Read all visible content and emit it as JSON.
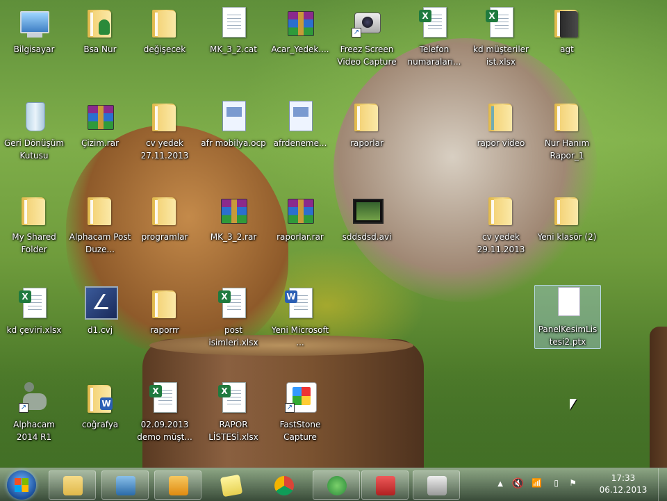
{
  "desktop_icons": [
    {
      "label": "Bilgisayar",
      "icon": "computer-icon"
    },
    {
      "label": "Bsa Nur",
      "icon": "user-folder-icon"
    },
    {
      "label": "değişecek",
      "icon": "folder-icon"
    },
    {
      "label": "MK_3_2.cat",
      "icon": "document-stack-icon"
    },
    {
      "label": "Acar_Yedek....",
      "icon": "winrar-archive-icon"
    },
    {
      "label": "Freez Screen Video Capture",
      "icon": "camera-icon"
    },
    {
      "label": "Telefon numaraları...",
      "icon": "excel-file-icon"
    },
    {
      "label": "kd müşteriler ist.xlsx",
      "icon": "excel-file-icon"
    },
    {
      "label": "agt",
      "icon": "folder-icon"
    },
    {
      "label": "Geri Dönüşüm Kutusu",
      "icon": "recycle-bin-icon"
    },
    {
      "label": "Çizim.rar",
      "icon": "winrar-archive-icon"
    },
    {
      "label": "cv yedek 27.11.2013",
      "icon": "folder-icon"
    },
    {
      "label": "afr mobilya.ocp",
      "icon": "ocp-file-icon"
    },
    {
      "label": "afrdeneme...",
      "icon": "ocp-file-icon"
    },
    {
      "label": "raporlar",
      "icon": "folder-icon"
    },
    {
      "label": "rapor video",
      "icon": "video-folder-icon"
    },
    {
      "label": "Nur Hanım Rapor_1",
      "icon": "folder-icon"
    },
    {
      "label": "My Shared Folder",
      "icon": "folder-icon"
    },
    {
      "label": "Alphacam Post Duze...",
      "icon": "folder-icon"
    },
    {
      "label": "programlar",
      "icon": "folder-icon"
    },
    {
      "label": "MK_3_2.rar",
      "icon": "winrar-archive-icon"
    },
    {
      "label": "raporlar.rar",
      "icon": "winrar-archive-icon"
    },
    {
      "label": "sddsdsd.avi",
      "icon": "video-file-icon"
    },
    {
      "label": "cv yedek 29.11.2013",
      "icon": "folder-icon"
    },
    {
      "label": "Yeni klasör (2)",
      "icon": "folder-icon"
    },
    {
      "label": "kd çeviri.xlsx",
      "icon": "excel-file-icon"
    },
    {
      "label": "d1.cvj",
      "icon": "cvj-file-icon"
    },
    {
      "label": "raporrr",
      "icon": "folder-icon"
    },
    {
      "label": "post isimleri.xlsx",
      "icon": "excel-file-icon"
    },
    {
      "label": "Yeni Microsoft ...",
      "icon": "word-file-icon"
    },
    {
      "label": "PanelKesimLis tesi2.ptx",
      "icon": "blank-file-icon"
    },
    {
      "label": "Alphacam 2014 R1",
      "icon": "alphacam-icon"
    },
    {
      "label": "coğrafya",
      "icon": "word-folder-icon"
    },
    {
      "label": "02.09.2013 demo müşt...",
      "icon": "excel-file-icon"
    },
    {
      "label": "RAPOR LİSTESİ.xlsx",
      "icon": "excel-file-icon"
    },
    {
      "label": "FastStone Capture",
      "icon": "faststone-icon"
    }
  ],
  "taskbar": {
    "start_button": "start-orb-icon",
    "items": [
      {
        "name": "windows-explorer-icon",
        "color": "#e8c25a"
      },
      {
        "name": "kd-app-icon",
        "color": "#3a7ab8"
      },
      {
        "name": "outlook-icon",
        "color": "#e8a020"
      },
      {
        "name": "sticky-notes-icon",
        "color": "#f0e070"
      },
      {
        "name": "chrome-icon",
        "color": "#dd4433"
      },
      {
        "name": "cv-app-icon",
        "color": "#3aa04a"
      },
      {
        "name": "keyboard-app-icon",
        "color": "#cc3333"
      },
      {
        "name": "camera-app-icon",
        "color": "#cccccc"
      }
    ],
    "tray": {
      "chevron": "▲",
      "time": "17:33",
      "date": "06.12.2013"
    }
  }
}
